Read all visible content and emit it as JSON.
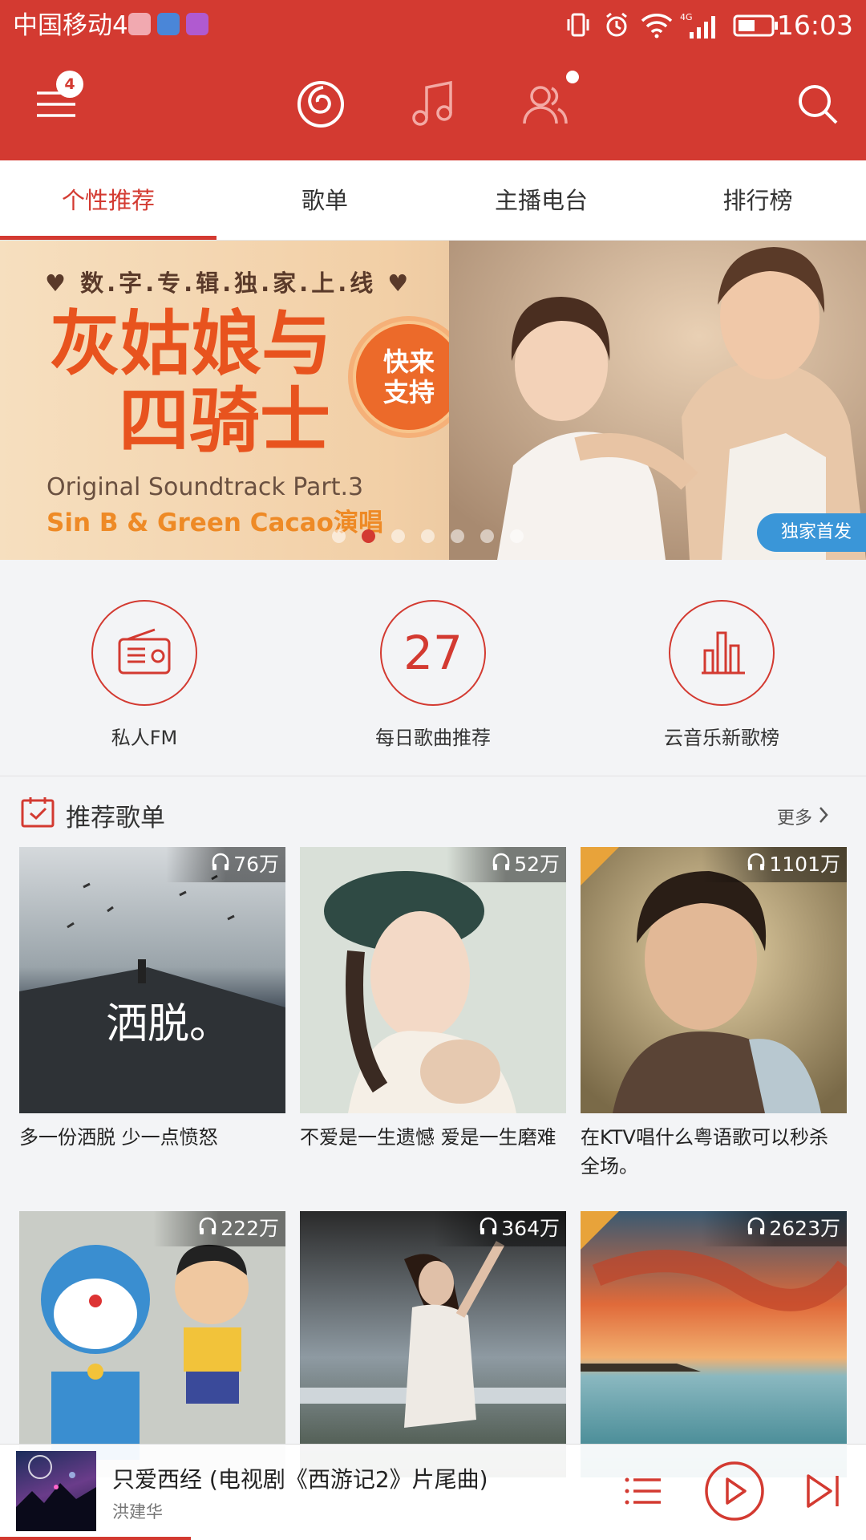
{
  "status_bar": {
    "carrier": "中国移动4G",
    "time": "16:03",
    "network_label": "4G"
  },
  "app_bar": {
    "menu_badge": "4",
    "icons": [
      "menu-icon",
      "netease-music-icon",
      "music-note-icon",
      "friends-icon",
      "search-icon"
    ]
  },
  "tabs": [
    {
      "label": "个性推荐",
      "active": true
    },
    {
      "label": "歌单",
      "active": false
    },
    {
      "label": "主播电台",
      "active": false
    },
    {
      "label": "排行榜",
      "active": false
    }
  ],
  "banner": {
    "subtitle": "♥ 数.字.专.辑.独.家.上.线 ♥",
    "title_line1": "灰姑娘与",
    "title_line2": "四骑士",
    "seal": "快来支持",
    "english_line1": "Original Soundtrack Part.3",
    "english_line2": "Sin B & Green Cacao演唱",
    "tag": "独家首发",
    "dot_count": 7,
    "active_dot": 1
  },
  "quick_entries": [
    {
      "label": "私人FM",
      "icon": "radio-icon"
    },
    {
      "label": "每日歌曲推荐",
      "number": "27"
    },
    {
      "label": "云音乐新歌榜",
      "icon": "chart-bars-icon"
    }
  ],
  "section": {
    "title": "推荐歌单",
    "more": "更多"
  },
  "playlists": [
    {
      "title": "多一份洒脱 少一点愤怒",
      "plays": "76万",
      "cover_text": "洒脱。",
      "corner": false
    },
    {
      "title": "不爱是一生遗憾 爱是一生磨难",
      "plays": "52万",
      "corner": false
    },
    {
      "title": "在KTV唱什么粤语歌可以秒杀全场。",
      "plays": "1101万",
      "corner": true
    },
    {
      "title": "",
      "plays": "222万",
      "corner": false
    },
    {
      "title": "",
      "plays": "364万",
      "corner": false
    },
    {
      "title": "",
      "plays": "2623万",
      "corner": true
    }
  ],
  "player": {
    "song": "只爱西经 (电视剧《西游记2》片尾曲)",
    "artist": "洪建华",
    "progress": 0.22
  },
  "colors": {
    "brand_red": "#d33a31",
    "banner_tag_blue": "#3a96d8",
    "corner_gold": "#e8a33a"
  }
}
